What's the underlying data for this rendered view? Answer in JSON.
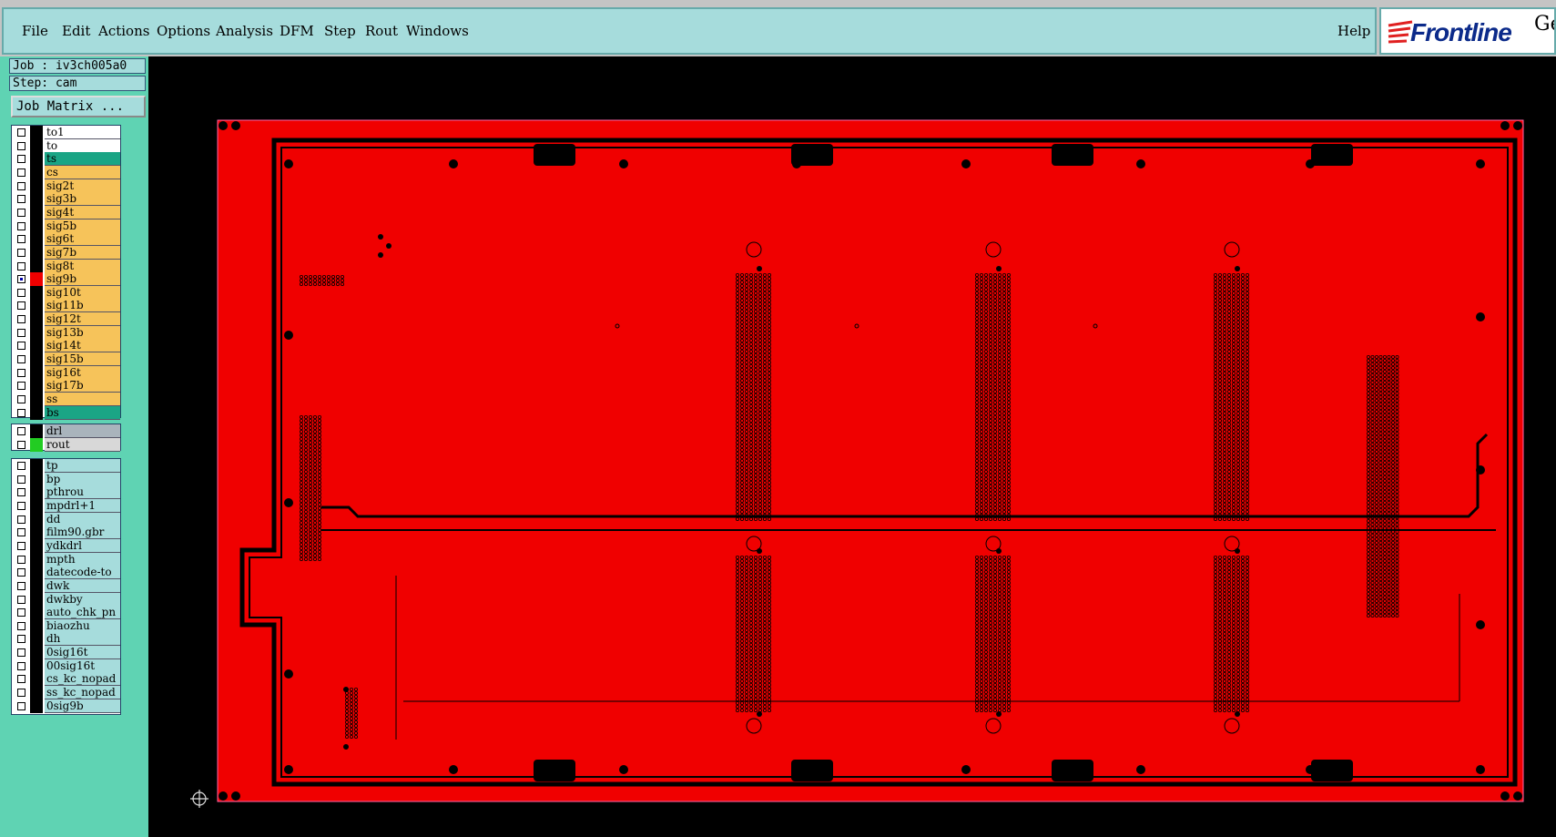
{
  "menu": {
    "items": [
      {
        "label": "File"
      },
      {
        "label": "Edit"
      },
      {
        "label": "Actions"
      },
      {
        "label": "Options"
      },
      {
        "label": "Analysis"
      },
      {
        "label": "DFM"
      },
      {
        "label": "Step"
      },
      {
        "label": "Rout"
      },
      {
        "label": "Windows"
      }
    ],
    "help": "Help"
  },
  "logo": {
    "text": "Frontline",
    "extra": "Ge"
  },
  "job": {
    "label": "Job : iv3ch005a0"
  },
  "step": {
    "label": "Step: cam"
  },
  "job_matrix": {
    "label": "Job Matrix ..."
  },
  "layers_signal": [
    {
      "name": "to1",
      "color": "#ffffff"
    },
    {
      "name": "to",
      "color": "#ffffff"
    },
    {
      "name": "ts",
      "color": "#1aa585"
    },
    {
      "name": "cs",
      "color": "#f6c35a"
    },
    {
      "name": "sig2t",
      "color": "#f6c35a"
    },
    {
      "name": "sig3b",
      "color": "#f6c35a"
    },
    {
      "name": "sig4t",
      "color": "#f6c35a"
    },
    {
      "name": "sig5b",
      "color": "#f6c35a"
    },
    {
      "name": "sig6t",
      "color": "#f6c35a"
    },
    {
      "name": "sig7b",
      "color": "#f6c35a"
    },
    {
      "name": "sig8t",
      "color": "#f6c35a"
    },
    {
      "name": "sig9b",
      "color": "#f6c35a",
      "active": true
    },
    {
      "name": "sig10t",
      "color": "#f6c35a"
    },
    {
      "name": "sig11b",
      "color": "#f6c35a"
    },
    {
      "name": "sig12t",
      "color": "#f6c35a"
    },
    {
      "name": "sig13b",
      "color": "#f6c35a"
    },
    {
      "name": "sig14t",
      "color": "#f6c35a"
    },
    {
      "name": "sig15b",
      "color": "#f6c35a"
    },
    {
      "name": "sig16t",
      "color": "#f6c35a"
    },
    {
      "name": "sig17b",
      "color": "#f6c35a"
    },
    {
      "name": "ss",
      "color": "#f6c35a"
    },
    {
      "name": "bs",
      "color": "#1aa585"
    }
  ],
  "layers_drill": [
    {
      "name": "drl",
      "color": "#a9b4bc"
    },
    {
      "name": "rout",
      "color": "#d8d8d8",
      "swatch": "#22cc22"
    }
  ],
  "layers_misc": [
    {
      "name": "tp"
    },
    {
      "name": "bp"
    },
    {
      "name": "pthrou"
    },
    {
      "name": "mpdrl+1"
    },
    {
      "name": "dd"
    },
    {
      "name": "film90.gbr"
    },
    {
      "name": "ydkdrl"
    },
    {
      "name": "mpth"
    },
    {
      "name": "datecode-to"
    },
    {
      "name": "dwk"
    },
    {
      "name": "dwkby"
    },
    {
      "name": "auto_chk_pn"
    },
    {
      "name": "biaozhu"
    },
    {
      "name": "dh"
    },
    {
      "name": "0sig16t"
    },
    {
      "name": "00sig16t"
    },
    {
      "name": "cs_kc_nopad"
    },
    {
      "name": "ss_kc_nopad"
    },
    {
      "name": "0sig9b"
    }
  ],
  "colors": {
    "menubar": "#a6dcdc",
    "panel": "#5fd3b3",
    "copper": "#f00000",
    "background": "#000000"
  }
}
